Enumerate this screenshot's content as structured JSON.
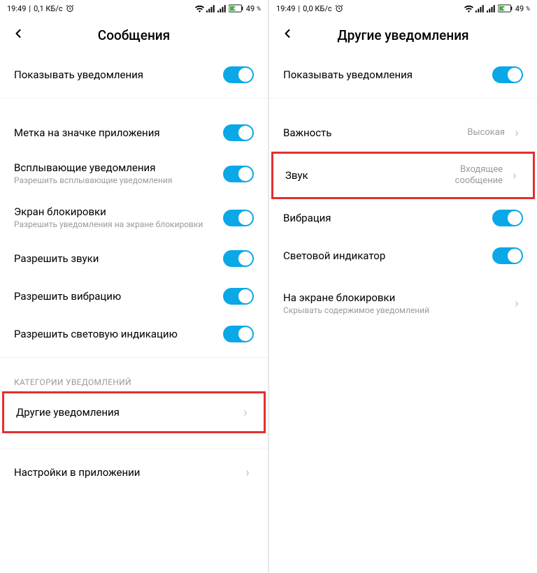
{
  "status": {
    "time": "19:49",
    "net_left": "0,1 КБ/с",
    "net_right": "0,0 КБ/с",
    "alarm": "⏰",
    "wifi": "wifi",
    "sim1": "sim",
    "sim2": "sim",
    "battery_percent": "49",
    "battery_suffix": "%"
  },
  "left": {
    "title": "Сообщения",
    "items": {
      "show": "Показывать уведомления",
      "badge": "Метка на значке приложения",
      "popup": "Всплывающие уведомления",
      "popup_sub": "Разрешить всплывающие уведомления",
      "lockscreen": "Экран блокировки",
      "lockscreen_sub": "Разрешить уведомления на экране блокировки",
      "sounds": "Разрешить звуки",
      "vibration": "Разрешить вибрацию",
      "led": "Разрешить световую индикацию",
      "section": "КАТЕГОРИИ УВЕДОМЛЕНИЙ",
      "other": "Другие уведомления",
      "appsettings": "Настройки в приложении"
    }
  },
  "right": {
    "title": "Другие уведомления",
    "items": {
      "show": "Показывать уведомления",
      "importance": "Важность",
      "importance_val": "Высокая",
      "sound": "Звук",
      "sound_val": "Входящее сообщение",
      "vibration": "Вибрация",
      "led": "Световой индикатор",
      "lockscreen": "На экране блокировки",
      "lockscreen_sub": "Скрывать содержимое уведомлений"
    }
  }
}
